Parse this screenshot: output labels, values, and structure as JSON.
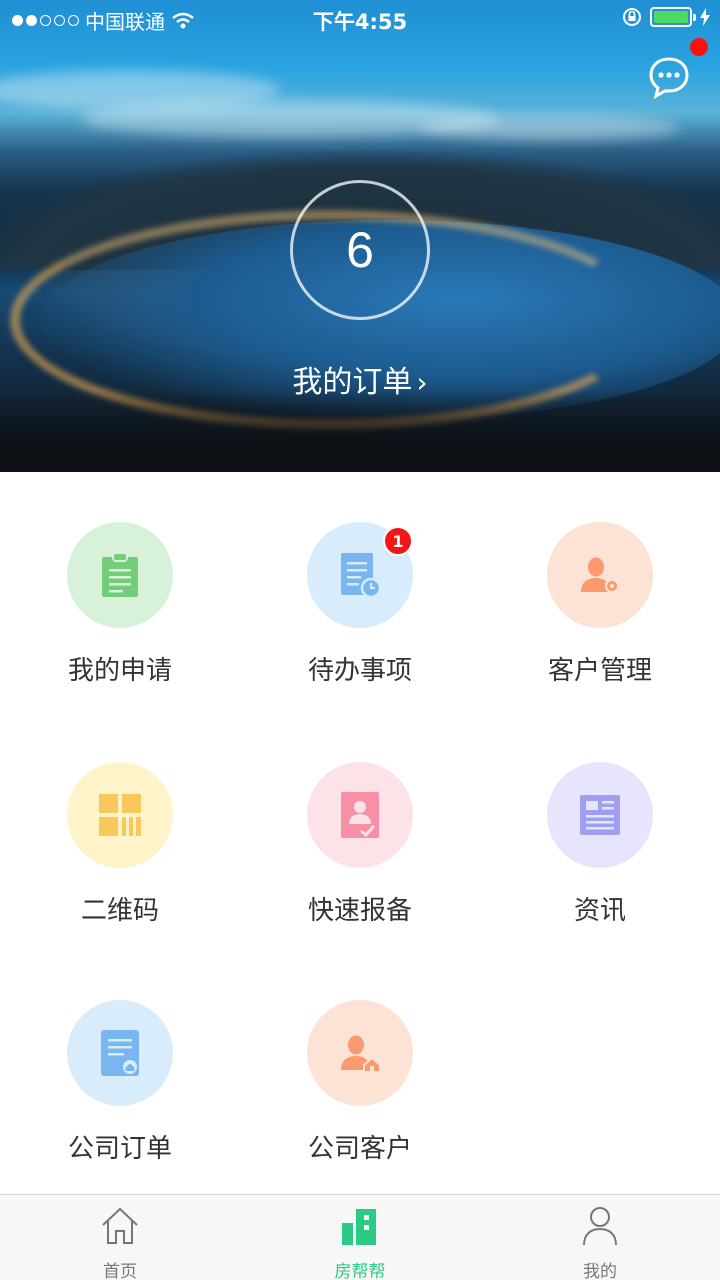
{
  "status_bar": {
    "carrier": "中国联通",
    "time": "下午4:55",
    "signal_icon": "signal-dots-icon",
    "wifi_icon": "wifi-icon",
    "lock_icon": "rotation-lock-icon",
    "battery_icon": "battery-charging-icon",
    "battery_color": "#4cd964"
  },
  "header": {
    "message_icon": "chat-bubble-icon",
    "has_unread": true,
    "unread_color": "#ff1010"
  },
  "order_summary": {
    "count": "6",
    "link_label": "我的订单",
    "chevron": "›"
  },
  "menu": {
    "items": [
      {
        "label": "我的申请",
        "icon": "clipboard-icon",
        "bg": "#d8f2d9",
        "color": "#72cc79"
      },
      {
        "label": "待办事项",
        "icon": "document-clock-icon",
        "bg": "#d9ecfb",
        "color": "#79b5ee",
        "badge": "1"
      },
      {
        "label": "客户管理",
        "icon": "user-gear-icon",
        "bg": "#fde2d6",
        "color": "#fa9a6e"
      },
      {
        "label": "二维码",
        "icon": "qr-code-icon",
        "bg": "#fff4c9",
        "color": "#fac85a"
      },
      {
        "label": "快速报备",
        "icon": "id-card-check-icon",
        "bg": "#fde3e8",
        "color": "#f790a6"
      },
      {
        "label": "资讯",
        "icon": "news-icon",
        "bg": "#e6e5fb",
        "color": "#9f9ef0"
      },
      {
        "label": "公司订单",
        "icon": "document-home-icon",
        "bg": "#d9ecfb",
        "color": "#79b5ee"
      },
      {
        "label": "公司客户",
        "icon": "user-home-icon",
        "bg": "#fde2d6",
        "color": "#fa9a6e"
      }
    ]
  },
  "tab_bar": {
    "tabs": [
      {
        "label": "首页",
        "icon": "home-icon"
      },
      {
        "label": "房帮帮",
        "icon": "buildings-icon",
        "active": true
      },
      {
        "label": "我的",
        "icon": "person-icon"
      }
    ],
    "active_color": "#2bcb86",
    "inactive_color": "#777777"
  }
}
